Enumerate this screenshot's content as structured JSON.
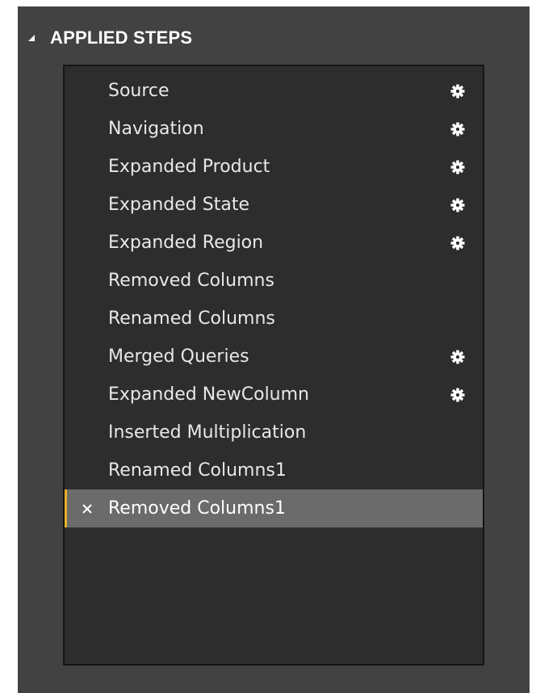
{
  "panel": {
    "header_title": "APPLIED STEPS",
    "collapse_icon": "triangle-collapse-icon"
  },
  "colors": {
    "panel_bg": "#424242",
    "list_bg": "#2d2d2d",
    "selected_bg": "#6b6b6b",
    "selected_accent": "#e6b02c",
    "text": "#e8e8e8"
  },
  "steps": [
    {
      "label": "Source",
      "has_settings": true,
      "selected": false
    },
    {
      "label": "Navigation",
      "has_settings": true,
      "selected": false
    },
    {
      "label": "Expanded Product",
      "has_settings": true,
      "selected": false
    },
    {
      "label": "Expanded State",
      "has_settings": true,
      "selected": false
    },
    {
      "label": "Expanded Region",
      "has_settings": true,
      "selected": false
    },
    {
      "label": "Removed Columns",
      "has_settings": false,
      "selected": false
    },
    {
      "label": "Renamed Columns",
      "has_settings": false,
      "selected": false
    },
    {
      "label": "Merged Queries",
      "has_settings": true,
      "selected": false
    },
    {
      "label": "Expanded NewColumn",
      "has_settings": true,
      "selected": false
    },
    {
      "label": "Inserted Multiplication",
      "has_settings": false,
      "selected": false
    },
    {
      "label": "Renamed Columns1",
      "has_settings": false,
      "selected": false
    },
    {
      "label": "Removed Columns1",
      "has_settings": false,
      "selected": true
    }
  ],
  "icons": {
    "settings": "gear-icon",
    "delete": "close-icon"
  }
}
